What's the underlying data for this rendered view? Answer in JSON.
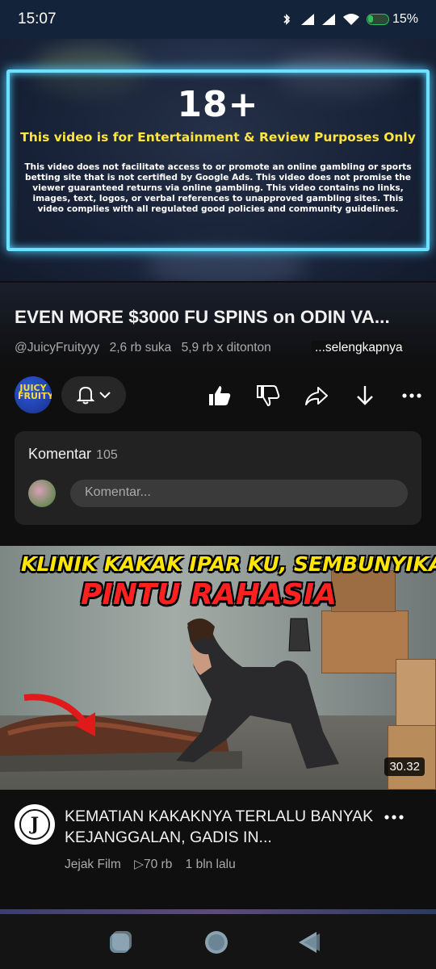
{
  "status_bar": {
    "time": "15:07",
    "battery": "15%"
  },
  "player": {
    "age_badge": "18+",
    "headline": "This video is for Entertainment & Review Purposes Only",
    "disclaimer": "This video does not facilitate access to or promote an online gambling or sports betting site that is not certified by Google Ads. This video does not promise the viewer guaranteed returns via online gambling. This video contains no links, images, text, logos, or verbal references to unapproved gambling sites. This video complies with all regulated good policies and community guidelines."
  },
  "video": {
    "title": "EVEN MORE $3000 FU SPINS on ODIN VA...",
    "channel": "@JuicyFruityyy",
    "likes": "2,6 rb suka",
    "views": "5,9 rb x ditonton",
    "more_label": "...selengkapnya",
    "channel_logo_text": "JUICY FRUITY"
  },
  "comments": {
    "label": "Komentar",
    "count": "105",
    "placeholder": "Komentar..."
  },
  "next_video": {
    "thumb_line1": "KLINIK KAKAK IPAR KU, SEMBUNYIKAN",
    "thumb_line2": "PINTU RAHASIA",
    "duration": "30.32",
    "channel_initial": "J",
    "title": "KEMATIAN KAKAKNYA TERLALU BANYAK KEJANGGALAN, GADIS IN...",
    "channel": "Jejak Film",
    "views": "▷70 rb",
    "age": "1 bln lalu"
  },
  "colors": {
    "accent_frame": "#6fe0ff",
    "headline_yellow": "#ffe63c",
    "thumb_red": "#ff2020"
  },
  "icons": [
    "wifi-icon",
    "signal-icon",
    "battery-icon",
    "bell-icon",
    "chevron-down-icon",
    "like-icon",
    "dislike-icon",
    "share-icon",
    "download-icon",
    "more-icon",
    "recents-icon",
    "home-icon",
    "back-icon"
  ]
}
